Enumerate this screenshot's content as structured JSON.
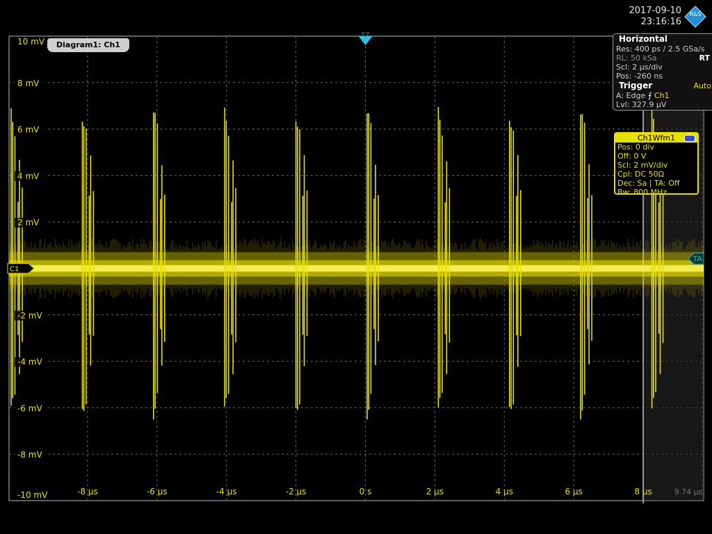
{
  "header": {
    "date": "2017-09-10",
    "time": "23:16:16",
    "logo": "R&S"
  },
  "diagram": {
    "tab_label": "Diagram1: Ch1",
    "channel_marker": "C1",
    "ta_marker": "TA"
  },
  "horizontal": {
    "title": "Horizontal",
    "res": "Res: 400 ps / 2.5 GSa/s",
    "rl": "RL:  50 kSa",
    "rt": "RT",
    "scl": "Scl:  2 µs/div",
    "pos": "Pos:  -260 ns"
  },
  "trigger": {
    "title": "Trigger",
    "mode": "Auto",
    "source_prefix": "A:    Edge",
    "source": "Ch1",
    "level": "Lvl:   327.9 µV"
  },
  "waveform": {
    "title": "Ch1Wfm1",
    "pos": "Pos: 0 div",
    "off": "Off:  0 V",
    "scl": "Scl:  2 mV/div",
    "cpl": "Cpl:  DC 50Ω",
    "dec": "Dec: Sa | TA: Off",
    "bw": "Bw:  800 MHz"
  },
  "colors": {
    "trace": "#e8e000",
    "grid": "#6a6a6a",
    "trigger": "#29c6e6",
    "ta": "#3aa8a8"
  },
  "chart_data": {
    "type": "line",
    "title": "",
    "xlabel": "",
    "ylabel": "",
    "xlim": [
      -10.26,
      9.74
    ],
    "ylim": [
      -10,
      10
    ],
    "x_ticks": [
      -8,
      -6,
      -4,
      -2,
      0,
      2,
      4,
      6,
      8
    ],
    "x_tick_labels": [
      "-8 µs",
      "-6 µs",
      "-4 µs",
      "-2 µs",
      "0 s",
      "2 µs",
      "4 µs",
      "6 µs",
      "8 µs"
    ],
    "x_end_label": "9.74 µs",
    "y_ticks": [
      10,
      8,
      6,
      4,
      2,
      -2,
      -4,
      -6,
      -8,
      -10
    ],
    "y_tick_labels": [
      "10 mV",
      "8 mV",
      "6 mV",
      "4 mV",
      "2 mV",
      "-2 mV",
      "-4 mV",
      "-6 mV",
      "-8 mV",
      "-10 mV"
    ],
    "grid": true,
    "baseline_mV": 0,
    "noise_band_mV": 0.7,
    "pulse_trains": [
      {
        "t": -10.2,
        "amplitude_mV": 7.0
      },
      {
        "t": -8.15,
        "amplitude_mV": 7.0
      },
      {
        "t": -6.1,
        "amplitude_mV": 7.0
      },
      {
        "t": -4.05,
        "amplitude_mV": 7.0
      },
      {
        "t": -2.0,
        "amplitude_mV": 7.0
      },
      {
        "t": 0.05,
        "amplitude_mV": 7.0
      },
      {
        "t": 2.1,
        "amplitude_mV": 7.0
      },
      {
        "t": 4.15,
        "amplitude_mV": 7.0
      },
      {
        "t": 6.2,
        "amplitude_mV": 7.0
      },
      {
        "t": 8.25,
        "amplitude_mV": 7.0
      }
    ],
    "trigger_time_us": 0,
    "trigger_level_mV": 0.33,
    "acquisition_end_us": 8.0
  }
}
